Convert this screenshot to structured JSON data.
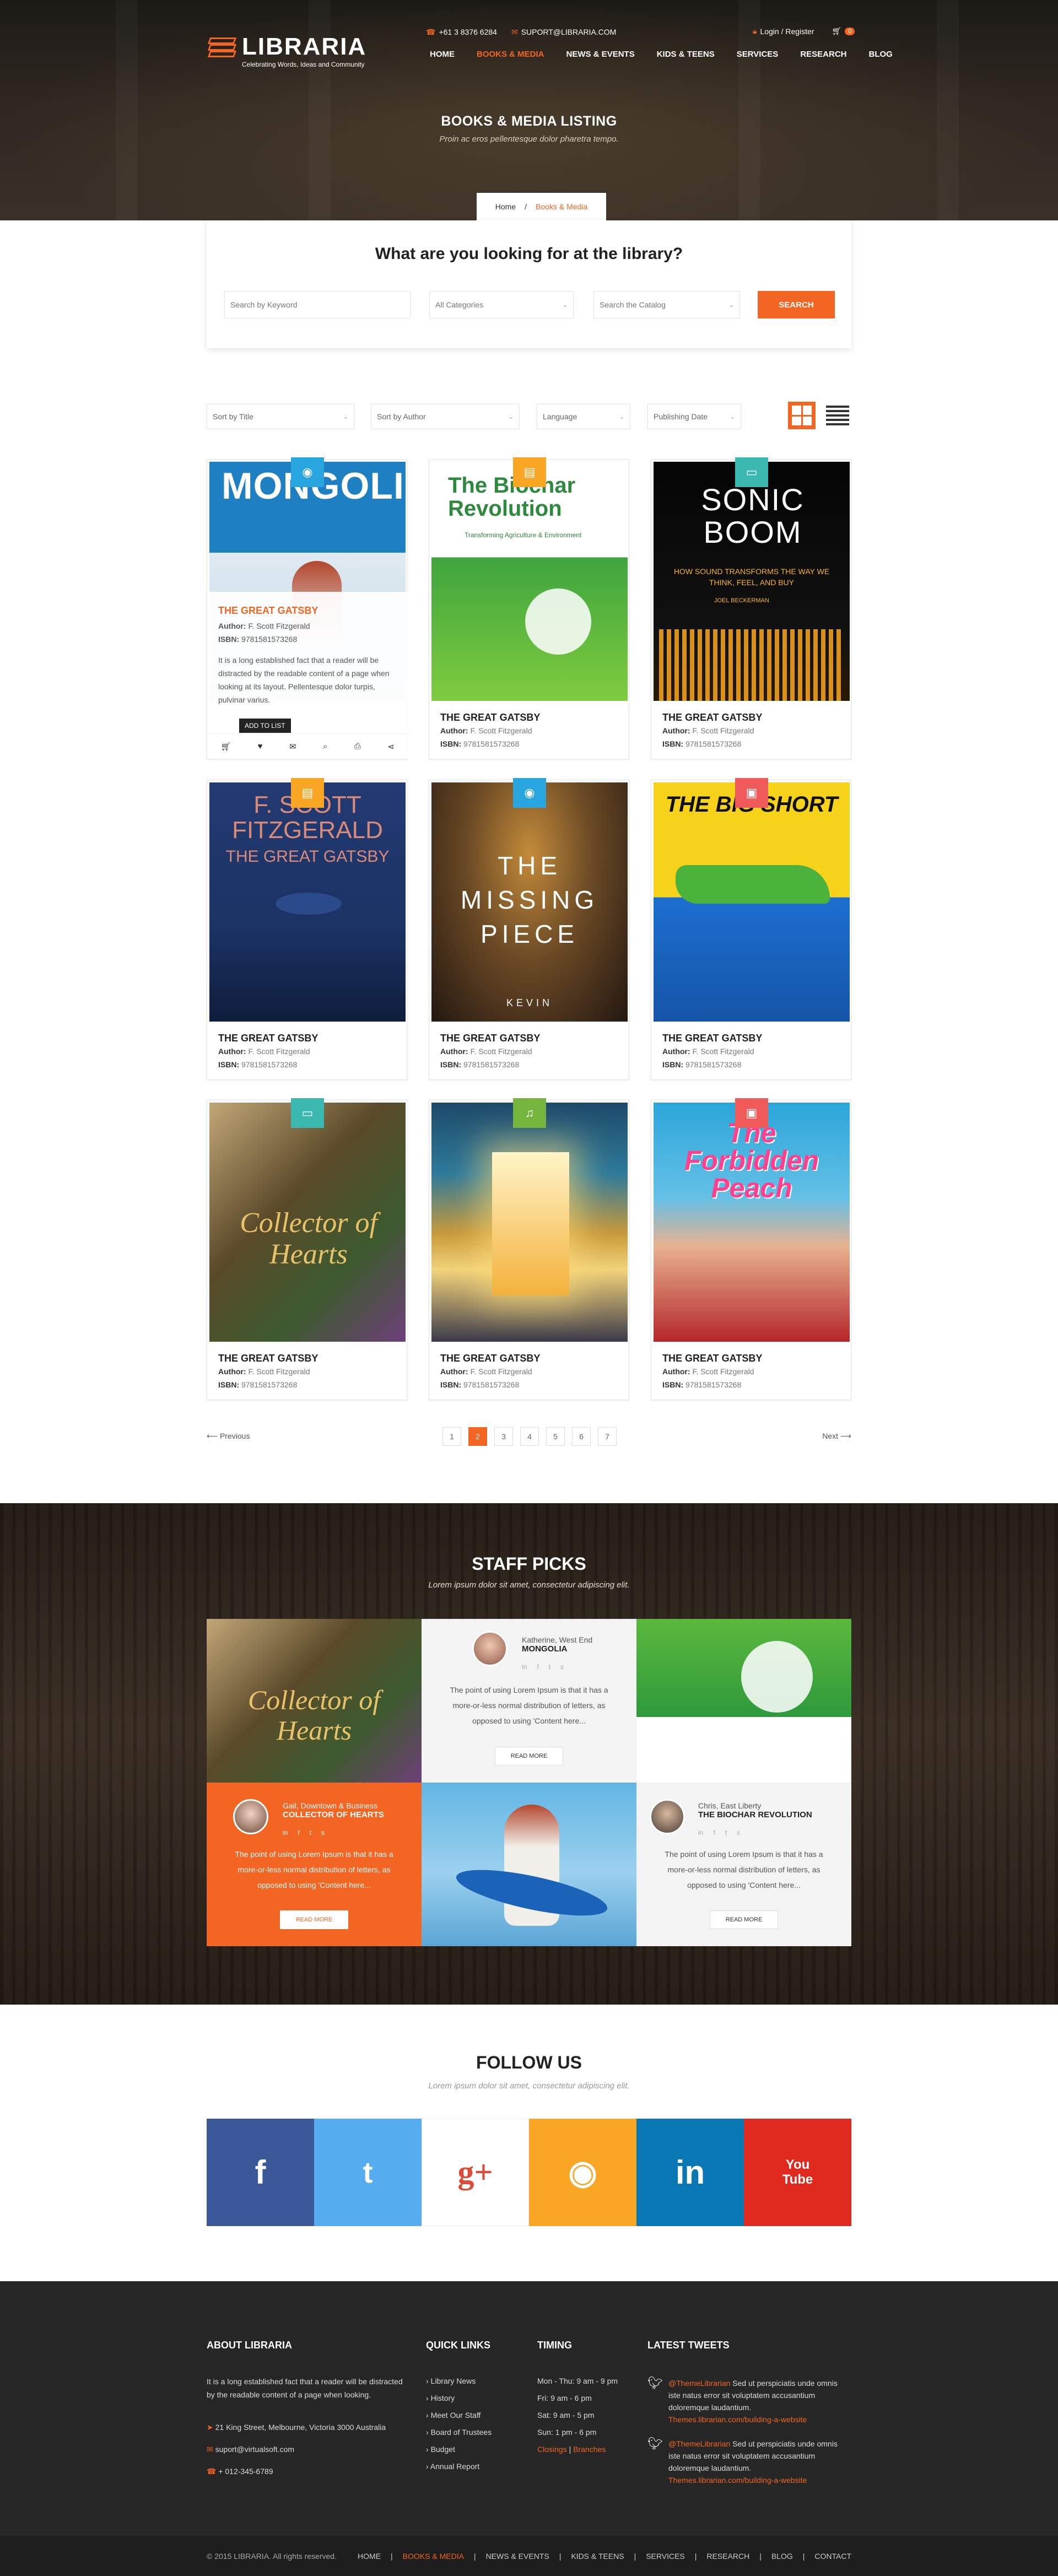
{
  "header": {
    "logo": {
      "name": "LIBRARIA",
      "tagline": "Celebrating Words, Ideas and Community"
    },
    "contact": {
      "phone": "+61 3 8376 6284",
      "email": "SUPORT@LIBRARIA.COM"
    },
    "auth": {
      "label": "Login / Register",
      "cart_count": "0"
    },
    "nav": [
      "HOME",
      "BOOKS & MEDIA",
      "NEWS & EVENTS",
      "KIDS & TEENS",
      "SERVICES",
      "RESEARCH",
      "BLOG"
    ],
    "nav_active": "BOOKS & MEDIA"
  },
  "hero": {
    "title": "BOOKS & MEDIA LISTING",
    "subtitle": "Proin ac eros pellentesque dolor pharetra tempo.",
    "breadcrumb": {
      "home": "Home",
      "sep": "/",
      "current": "Books & Media"
    }
  },
  "search": {
    "heading": "What are you looking for at the library?",
    "keyword_placeholder": "Search by Keyword",
    "category": "All Categories",
    "catalog": "Search the Catalog",
    "button": "SEARCH"
  },
  "filters": {
    "title": "Sort by Title",
    "author": "Sort by Author",
    "language": "Language",
    "date": "Publishing Date"
  },
  "books": [
    {
      "title": "THE GREAT GATSBY",
      "author_label": "Author:",
      "author": "F. Scott Fitzgerald",
      "isbn_label": "ISBN:",
      "isbn": "9781581573268",
      "cover_text": "MONGOLIA",
      "badge_color": "#29a6e0",
      "badge_icon": "cd-icon"
    },
    {
      "title": "THE GREAT GATSBY",
      "author_label": "Author:",
      "author": "F. Scott Fitzgerald",
      "isbn_label": "ISBN:",
      "isbn": "9781581573268",
      "cover_text": "The Biochar Revolution",
      "cover_sub": "Transforming Agriculture & Environment",
      "badge_color": "#f8a623",
      "badge_icon": "book-icon"
    },
    {
      "title": "THE GREAT GATSBY",
      "author_label": "Author:",
      "author": "F. Scott Fitzgerald",
      "isbn_label": "ISBN:",
      "isbn": "9781581573268",
      "cover_text": "SONIC BOOM",
      "cover_sub": "HOW SOUND TRANSFORMS THE WAY WE THINK, FEEL, AND BUY",
      "cover_author": "JOEL BECKERMAN",
      "badge_color": "#3bb8b0",
      "badge_icon": "ebook-icon"
    },
    {
      "title": "THE GREAT GATSBY",
      "author_label": "Author:",
      "author": "F. Scott Fitzgerald",
      "isbn_label": "ISBN:",
      "isbn": "9781581573268",
      "cover_text": "F. SCOTT FITZGERALD",
      "cover_sub": "THE GREAT GATSBY",
      "badge_color": "#f8a623",
      "badge_icon": "book-icon"
    },
    {
      "title": "THE GREAT GATSBY",
      "author_label": "Author:",
      "author": "F. Scott Fitzgerald",
      "isbn_label": "ISBN:",
      "isbn": "9781581573268",
      "cover_text": "THE MISSING PIECE",
      "cover_author": "KEVIN",
      "badge_color": "#29a6e0",
      "badge_icon": "cd-icon"
    },
    {
      "title": "THE GREAT GATSBY",
      "author_label": "Author:",
      "author": "F. Scott Fitzgerald",
      "isbn_label": "ISBN:",
      "isbn": "9781581573268",
      "cover_text": "THE BIG SHORT",
      "badge_color": "#f15a5a",
      "badge_icon": "magazine-icon"
    },
    {
      "title": "THE GREAT GATSBY",
      "author_label": "Author:",
      "author": "F. Scott Fitzgerald",
      "isbn_label": "ISBN:",
      "isbn": "9781581573268",
      "cover_text": "Collector of Hearts",
      "badge_color": "#3bb8b0",
      "badge_icon": "ebook-icon"
    },
    {
      "title": "THE GREAT GATSBY",
      "author_label": "Author:",
      "author": "F. Scott Fitzgerald",
      "isbn_label": "ISBN:",
      "isbn": "9781581573268",
      "cover_text": "",
      "badge_color": "#76b53d",
      "badge_icon": "audio-book-icon"
    },
    {
      "title": "THE GREAT GATSBY",
      "author_label": "Author:",
      "author": "F. Scott Fitzgerald",
      "isbn_label": "ISBN:",
      "isbn": "9781581573268",
      "cover_text": "The Forbidden Peach",
      "badge_color": "#f15a5a",
      "badge_icon": "magazine-icon"
    }
  ],
  "hover_card": {
    "description": "It is a long established fact that a reader will be distracted by the readable content of a page when looking at its layout. Pellentesque dolor turpis, pulvinar varius.",
    "tooltip": "ADD TO LIST"
  },
  "pagination": {
    "prev": "Previous",
    "next": "Next",
    "pages": [
      "1",
      "2",
      "3",
      "4",
      "5",
      "6",
      "7"
    ],
    "active": "2"
  },
  "staff": {
    "title": "STAFF PICKS",
    "subtitle": "Lorem ipsum dolor sit amet, consectetur adipiscing elit.",
    "picks": [
      {
        "who": "Katherine, West End",
        "book": "MONGOLIA",
        "text": "The point of using Lorem Ipsum is that it has a more-or-less normal distribution of letters, as opposed to using 'Content here...",
        "button": "READ MORE"
      },
      {
        "who": "Gail, Downtown & Business",
        "book": "COLLECTOR OF HEARTS",
        "text": "The point of using Lorem Ipsum is that it has a more-or-less normal distribution of letters, as opposed to using 'Content here...",
        "button": "READ MORE"
      },
      {
        "who": "Chris, East Liberty",
        "book": "THE BIOCHAR REVOLUTION",
        "text": "The point of using Lorem Ipsum is that it has a more-or-less normal distribution of letters, as opposed to using 'Content here...",
        "button": "READ MORE"
      }
    ],
    "cover_texts": {
      "collector": "Collector of Hearts"
    }
  },
  "follow": {
    "title": "FOLLOW US",
    "subtitle": "Lorem ipsum dolor sit amet, consectetur adipiscing elit.",
    "networks": [
      {
        "name": "facebook-icon",
        "glyph": "f",
        "color": "#3b5998"
      },
      {
        "name": "twitter-icon",
        "glyph": "t",
        "color": "#55acee"
      },
      {
        "name": "google-plus-icon",
        "glyph": "g+",
        "color": "#ffffff"
      },
      {
        "name": "rss-icon",
        "glyph": "◉",
        "color": "#f8a623"
      },
      {
        "name": "linkedin-icon",
        "glyph": "in",
        "color": "#0a77b5"
      },
      {
        "name": "youtube-icon",
        "glyph": "You Tube",
        "color": "#e02a20"
      }
    ]
  },
  "footer": {
    "about": {
      "heading": "ABOUT LIBRARIA",
      "text": "It is a long established fact that a reader will be distracted by the readable content of a page when looking.",
      "address": "21 King Street, Melbourne, Victoria 3000 Australia",
      "email": "suport@virtualsoft.com",
      "phone": "+ 012-345-6789"
    },
    "quick_links": {
      "heading": "QUICK LINKS",
      "items": [
        "Library News",
        "History",
        "Meet Our Staff",
        "Board of Trustees",
        "Budget",
        "Annual Report"
      ]
    },
    "timing": {
      "heading": "TIMING",
      "items": [
        "Mon - Thu: 9 am - 9 pm",
        "Fri: 9 am - 6 pm",
        "Sat: 9 am - 5 pm",
        "Sun: 1 pm - 6 pm"
      ],
      "closings": "Closings",
      "sep": "|",
      "branches": "Branches"
    },
    "tweets": {
      "heading": "LATEST TWEETS",
      "items": [
        {
          "handle": "@ThemeLibrarian",
          "text": "Sed ut perspiciatis unde omnis iste natus error sit voluptatem accusantium doloremque laudantium.",
          "link": "Themes.librarian.com/building-a-website"
        },
        {
          "handle": "@ThemeLibrarian",
          "text": "Sed ut perspiciatis unde omnis iste natus error sit voluptatem accusantium doloremque laudantium.",
          "link": "Themes.librarian.com/building-a-website"
        }
      ]
    },
    "copyright": "© 2015 LIBRARIA. All rights reserved.",
    "nav": [
      "HOME",
      "BOOKS & MEDIA",
      "NEWS & EVENTS",
      "KIDS & TEENS",
      "SERVICES",
      "RESEARCH",
      "BLOG",
      "CONTACT"
    ]
  }
}
